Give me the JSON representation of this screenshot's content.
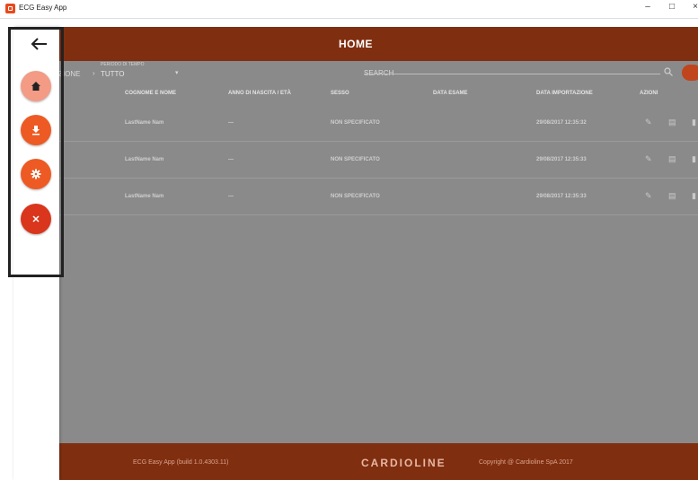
{
  "window": {
    "title": "ECG Easy App",
    "minimize": "–",
    "maximize": "□",
    "close": "×"
  },
  "header": {
    "title": "HOME"
  },
  "filters": {
    "partial_label": "ZIONE",
    "arrow": "›",
    "period_label": "PERIODO DI TEMPO",
    "period_value": "TUTTO",
    "search_placeholder": "SEARCH"
  },
  "table": {
    "columns": [
      "COGNOME E NOME",
      "ANNO DI NASCITA / ETÀ",
      "SESSO",
      "DATA ESAME",
      "DATA IMPORTAZIONE",
      "AZIONI"
    ],
    "rows": [
      {
        "name": "LastName Nam",
        "birth": "—",
        "sex": "NON SPECIFICATO",
        "exam": "",
        "imported": "29/08/2017 12:35:32"
      },
      {
        "name": "LastName Nam",
        "birth": "—",
        "sex": "NON SPECIFICATO",
        "exam": "",
        "imported": "29/08/2017 12:35:33"
      },
      {
        "name": "LastName Nam",
        "birth": "—",
        "sex": "NON SPECIFICATO",
        "exam": "",
        "imported": "29/08/2017 12:35:33"
      }
    ]
  },
  "footer": {
    "build": "ECG Easy App (build 1.0.4303.11)",
    "brand": "CARDIOLINE",
    "copyright": "Copyright @ Cardioline SpA 2017"
  },
  "drawer": {
    "items": [
      {
        "icon": "home-icon",
        "color": "#f39b85"
      },
      {
        "icon": "download-icon",
        "color": "#ee5a24"
      },
      {
        "icon": "gear-icon",
        "color": "#ee5a24"
      },
      {
        "icon": "close-icon",
        "color": "#d9361d"
      }
    ]
  },
  "colors": {
    "brand": "#802e10",
    "accent": "#ee5a24"
  }
}
